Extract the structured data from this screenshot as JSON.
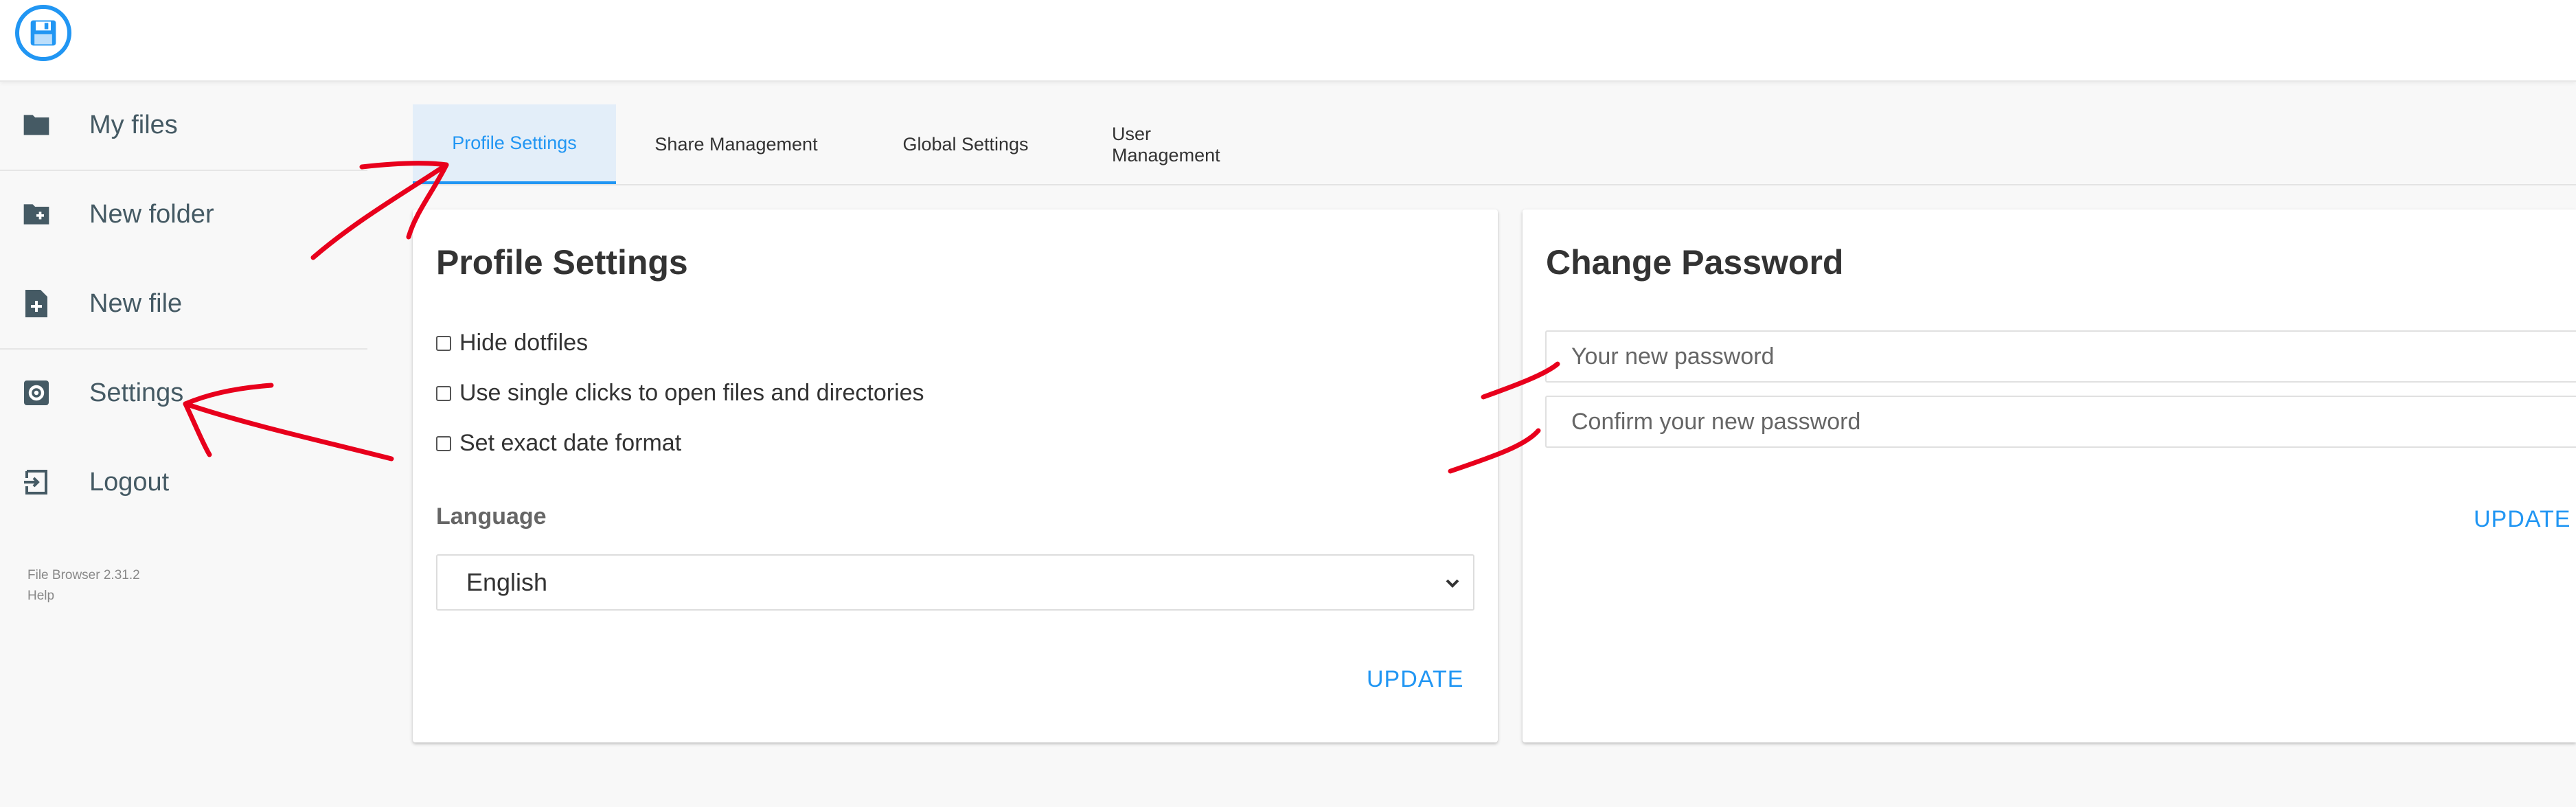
{
  "sidebar": {
    "items": [
      {
        "label": "My files",
        "icon": "folder-icon"
      },
      {
        "label": "New folder",
        "icon": "folder-plus-icon"
      },
      {
        "label": "New file",
        "icon": "file-plus-icon"
      },
      {
        "label": "Settings",
        "icon": "gear-icon"
      },
      {
        "label": "Logout",
        "icon": "logout-icon"
      }
    ],
    "credits": {
      "version": "File Browser 2.31.2",
      "help": "Help"
    }
  },
  "tabs": [
    {
      "label": "Profile Settings",
      "active": true
    },
    {
      "label": "Share Management",
      "active": false
    },
    {
      "label": "Global Settings",
      "active": false
    },
    {
      "label": "User Management",
      "active": false
    }
  ],
  "profile": {
    "title": "Profile Settings",
    "options": [
      {
        "label": "Hide dotfiles",
        "checked": false
      },
      {
        "label": "Use single clicks to open files and directories",
        "checked": false
      },
      {
        "label": "Set exact date format",
        "checked": false
      }
    ],
    "language_label": "Language",
    "language_value": "English",
    "update_label": "UPDATE"
  },
  "password": {
    "title": "Change Password",
    "new_placeholder": "Your new password",
    "confirm_placeholder": "Confirm your new password",
    "update_label": "UPDATE"
  },
  "colors": {
    "accent": "#2196f3",
    "annotation": "#e8001c",
    "sidebar_text": "#455a64"
  }
}
